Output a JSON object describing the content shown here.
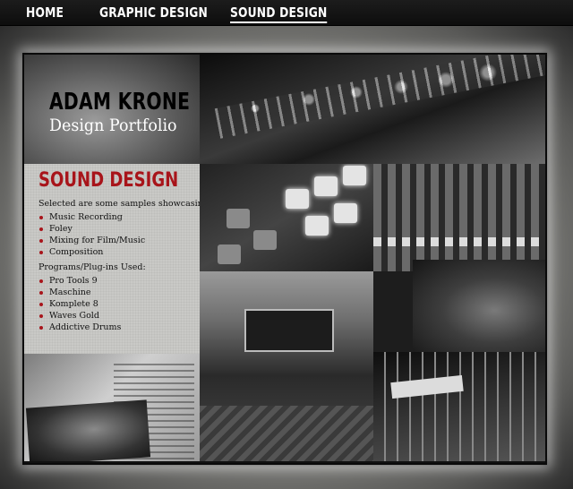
{
  "nav": {
    "items": [
      {
        "label": "HOME"
      },
      {
        "label": "GRAPHIC DESIGN"
      },
      {
        "label": "SOUND DESIGN"
      }
    ],
    "active": "SOUND DESIGN"
  },
  "header": {
    "name": "ADAM KRONE",
    "subtitle": "Design Portfolio"
  },
  "panel": {
    "title": "SOUND DESIGN",
    "intro": "Selected are some samples showcasing:",
    "showcase_items": [
      "Music Recording",
      "Foley",
      "Mixing for Film/Music",
      "Composition"
    ],
    "tools_heading": "Programs/Plug-ins Used:",
    "tools_items": [
      "Pro Tools 9",
      "Maschine",
      "Komplete 8",
      "Waves Gold",
      "Addictive Drums"
    ]
  },
  "colors": {
    "accent": "#a8141a",
    "nav_bg": "#111111",
    "panel_bg": "#c9c9c6"
  },
  "photos": [
    "rack-gear-photo",
    "drum-pad-photo",
    "mixer-faders-photo",
    "recording-studio-photo",
    "statue-render-photo",
    "mixing-console-photo",
    "daw-screenshot-photo"
  ]
}
